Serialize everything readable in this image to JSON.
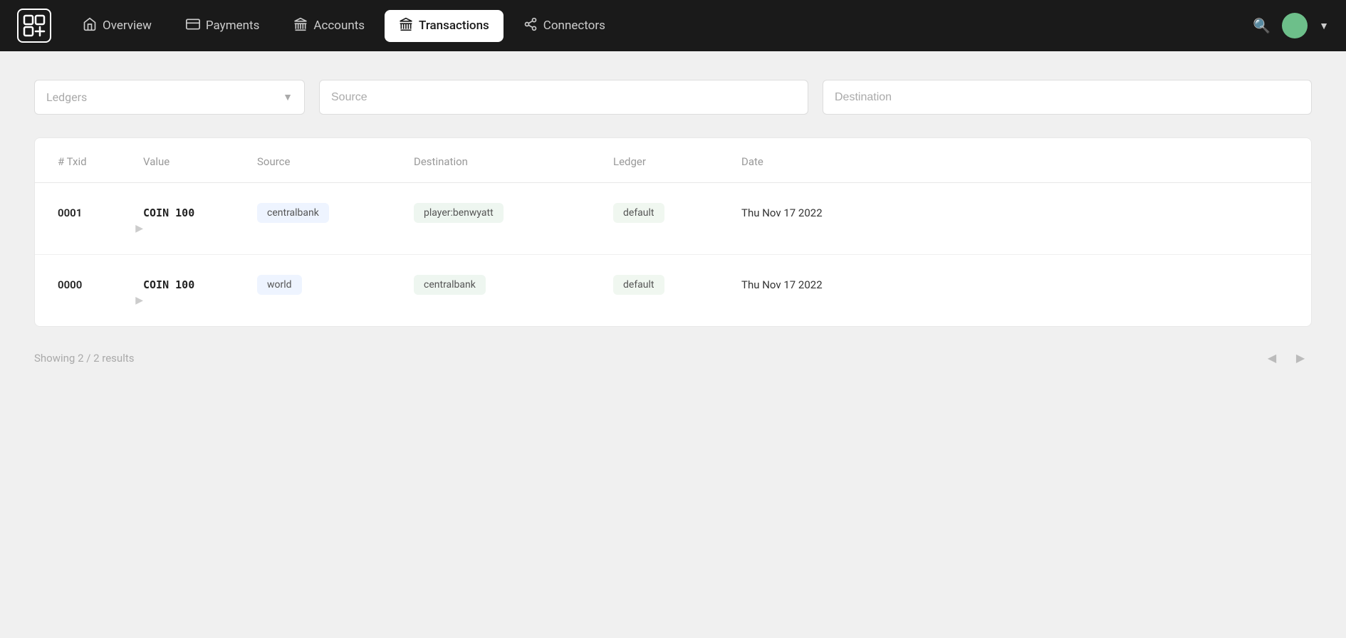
{
  "navbar": {
    "logo_alt": "Logo",
    "items": [
      {
        "id": "overview",
        "label": "Overview",
        "icon": "home-icon",
        "active": false
      },
      {
        "id": "payments",
        "label": "Payments",
        "icon": "card-icon",
        "active": false
      },
      {
        "id": "accounts",
        "label": "Accounts",
        "icon": "bank-icon",
        "active": false
      },
      {
        "id": "transactions",
        "label": "Transactions",
        "icon": "bank-icon",
        "active": true
      },
      {
        "id": "connectors",
        "label": "Connectors",
        "icon": "share-icon",
        "active": false
      }
    ]
  },
  "filters": {
    "ledgers_placeholder": "Ledgers",
    "source_placeholder": "Source",
    "destination_placeholder": "Destination"
  },
  "table": {
    "columns": [
      "# Txid",
      "Value",
      "Source",
      "Destination",
      "Ledger",
      "Date"
    ],
    "rows": [
      {
        "txid": "0001",
        "value": "COIN 100",
        "source": "centralbank",
        "destination": "player:benwyatt",
        "ledger": "default",
        "date": "Thu Nov 17 2022"
      },
      {
        "txid": "0000",
        "value": "COIN 100",
        "source": "world",
        "destination": "centralbank",
        "ledger": "default",
        "date": "Thu Nov 17 2022"
      }
    ]
  },
  "pagination": {
    "showing": "Showing 2 / 2 results"
  },
  "colors": {
    "nav_bg": "#1a1a1a",
    "active_bg": "#ffffff",
    "tag_bg": "#eef4ff",
    "ledger_bg": "#eef6f0"
  }
}
